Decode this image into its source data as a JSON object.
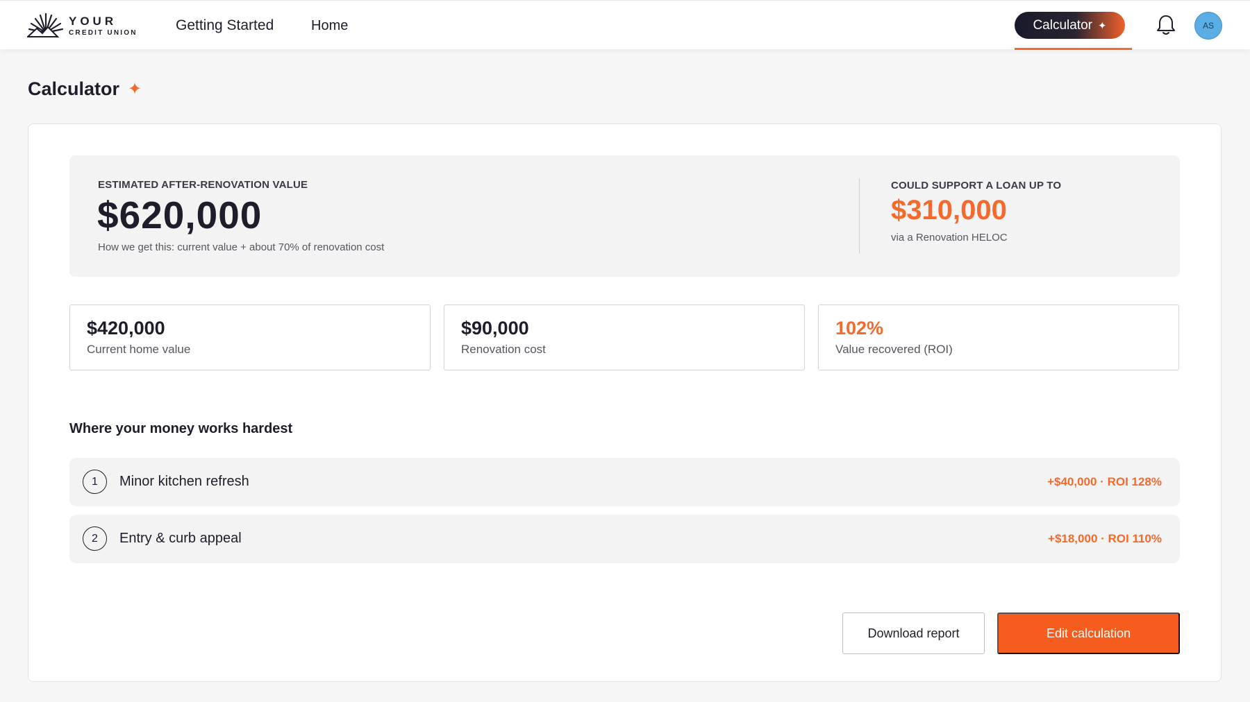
{
  "header": {
    "logo": {
      "word": "YOUR",
      "sub": "CREDIT UNION",
      "icon": "sunburst-logo-icon"
    },
    "nav": [
      {
        "label": "Getting Started"
      },
      {
        "label": "Home"
      }
    ],
    "calculator_pill": {
      "label": "Calculator",
      "icon": "sparkle-icon"
    },
    "notifications_icon": "bell-icon",
    "avatar_initials": "AS"
  },
  "page": {
    "title": "Calculator",
    "title_icon": "sparkle-icon"
  },
  "summary": {
    "estimated_label": "ESTIMATED AFTER-RENOVATION VALUE",
    "estimated_value": "$620,000",
    "estimated_note": "How we get this: current value + about 70% of renovation cost",
    "loan_label": "COULD SUPPORT A LOAN UP TO",
    "loan_value": "$310,000",
    "loan_note": "via a Renovation HELOC"
  },
  "stats": [
    {
      "value": "$420,000",
      "label": "Current home value"
    },
    {
      "value": "$90,000",
      "label": "Renovation cost"
    },
    {
      "value": "102%",
      "label": "Value recovered (ROI)"
    }
  ],
  "projects": {
    "title": "Where your money works hardest",
    "items": [
      {
        "number": "1",
        "label": "Minor kitchen refresh",
        "value": "+$40,000 · ROI 128%"
      },
      {
        "number": "2",
        "label": "Entry & curb appeal",
        "value": "+$18,000 · ROI 110%"
      }
    ]
  },
  "actions": {
    "download": "Download report",
    "edit": "Edit calculation"
  },
  "colors": {
    "accent": "#f36a2c",
    "primary_button": "#f75c1f",
    "text_dark": "#1d1d2b",
    "avatar": "#5aaee3"
  }
}
